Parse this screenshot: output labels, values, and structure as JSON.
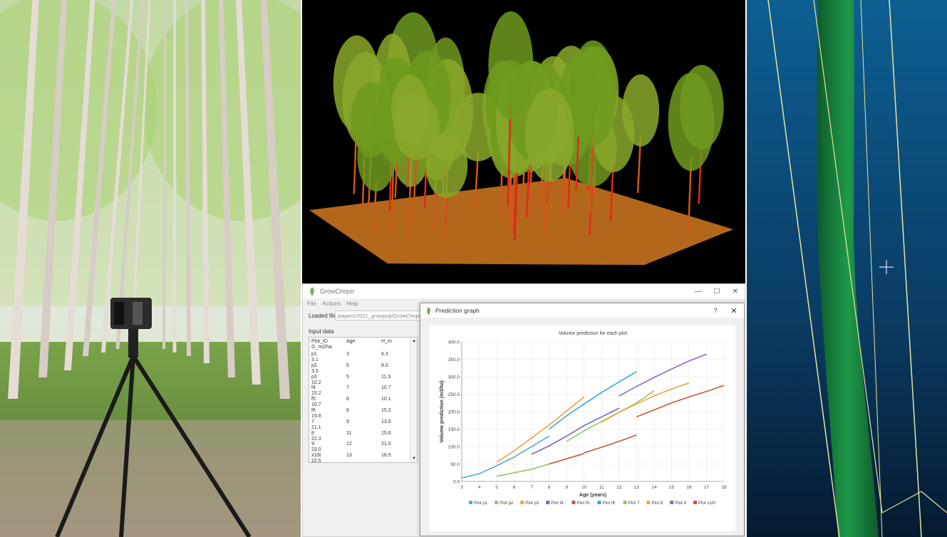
{
  "app": {
    "title": "GrowChopo",
    "menu": [
      "File",
      "Actions",
      "Help"
    ],
    "window_controls": [
      "—",
      "☐",
      "✕"
    ],
    "loaded_file_label": "Loaded file",
    "loaded_file_value": "/papers/2021_growpop/GrowChopo_20",
    "input_data_label": "Input data",
    "table": {
      "headers": [
        "Plot_ID",
        "Age",
        "H_m"
      ],
      "extra_header": "G_m2/ha",
      "rows": [
        {
          "plot": "p1",
          "age": "3",
          "h": "6.3",
          "g": "3.1"
        },
        {
          "plot": "p2",
          "age": "5",
          "h": "8.0",
          "g": "3.5"
        },
        {
          "plot": "p3",
          "age": "5",
          "h": "11.3",
          "g": "10.2"
        },
        {
          "plot": "f4",
          "age": "7",
          "h": "10.7",
          "g": "15.2"
        },
        {
          "plot": "f5",
          "age": "8",
          "h": "10.1",
          "g": "10.7"
        },
        {
          "plot": "f6",
          "age": "8",
          "h": "15.2",
          "g": "19.8"
        },
        {
          "plot": "7",
          "age": "9",
          "h": "13.0",
          "g": "21.1"
        },
        {
          "plot": "8",
          "age": "11",
          "h": "15.6",
          "g": "22.3"
        },
        {
          "plot": "9",
          "age": "12",
          "h": "21.0",
          "g": "23.0"
        },
        {
          "plot": "x10t",
          "age": "13",
          "h": "16.5",
          "g": "22.5"
        }
      ]
    }
  },
  "dialog": {
    "title": "Prediction graph",
    "help": "?",
    "close": "✕"
  },
  "chart_data": {
    "type": "line",
    "title": "Volume prediction for each plot",
    "xlabel": "Age (years)",
    "ylabel": "Volume prediction (m3/ha)",
    "xlim": [
      3,
      18
    ],
    "ylim": [
      0,
      400
    ],
    "xticks": [
      "3",
      "4",
      "5",
      "6",
      "7",
      "8",
      "9",
      "10",
      "11",
      "12",
      "13",
      "14",
      "15",
      "16",
      "17",
      "18"
    ],
    "yticks": [
      "0.0",
      "50.0",
      "100.0",
      "150.0",
      "200.0",
      "250.0",
      "300.0",
      "350.0",
      "400.0"
    ],
    "legend_position": "bottom",
    "series": [
      {
        "name": "Plot p1",
        "color": "#5aa5d6",
        "x": [
          3,
          4,
          5,
          6,
          7,
          8
        ],
        "y": [
          10,
          22,
          45,
          70,
          100,
          130
        ]
      },
      {
        "name": "Plot p2",
        "color": "#8fc862",
        "x": [
          5,
          6,
          7,
          8
        ],
        "y": [
          15,
          25,
          35,
          50
        ]
      },
      {
        "name": "Plot p3",
        "color": "#f0a33a",
        "x": [
          5,
          6,
          7,
          8,
          9,
          10
        ],
        "y": [
          55,
          88,
          125,
          162,
          202,
          242
        ]
      },
      {
        "name": "Plot f4",
        "color": "#7766c8",
        "x": [
          7,
          8,
          9,
          10,
          11,
          12
        ],
        "y": [
          78,
          102,
          130,
          160,
          185,
          210
        ]
      },
      {
        "name": "Plot f5",
        "color": "#c05a3c",
        "x": [
          8,
          9,
          10
        ],
        "y": [
          50,
          65,
          80
        ]
      },
      {
        "name": "Plot f6",
        "color": "#3aa6d6",
        "x": [
          8,
          9,
          10,
          11,
          12,
          13
        ],
        "y": [
          150,
          188,
          222,
          255,
          285,
          315
        ]
      },
      {
        "name": "Plot 7",
        "color": "#8fc862",
        "x": [
          9,
          10,
          11,
          12,
          13,
          14
        ],
        "y": [
          115,
          145,
          172,
          198,
          225,
          260
        ]
      },
      {
        "name": "Plot 8",
        "color": "#f0a33a",
        "x": [
          11,
          12,
          13,
          14,
          15,
          16
        ],
        "y": [
          170,
          198,
          222,
          245,
          265,
          282
        ]
      },
      {
        "name": "Plot 9",
        "color": "#8a66d0",
        "x": [
          12,
          13,
          14,
          15,
          16,
          17
        ],
        "y": [
          245,
          272,
          298,
          322,
          345,
          365
        ]
      },
      {
        "name": "Plot x10t",
        "color": "#c05a3c",
        "x": [
          13,
          14,
          15,
          16,
          17,
          18
        ],
        "y": [
          185,
          205,
          225,
          242,
          258,
          275
        ]
      }
    ],
    "extra_segments": [
      {
        "color": "#c05a3c",
        "x": [
          10,
          11,
          12,
          13
        ],
        "y": [
          82,
          98,
          115,
          133
        ]
      }
    ]
  }
}
